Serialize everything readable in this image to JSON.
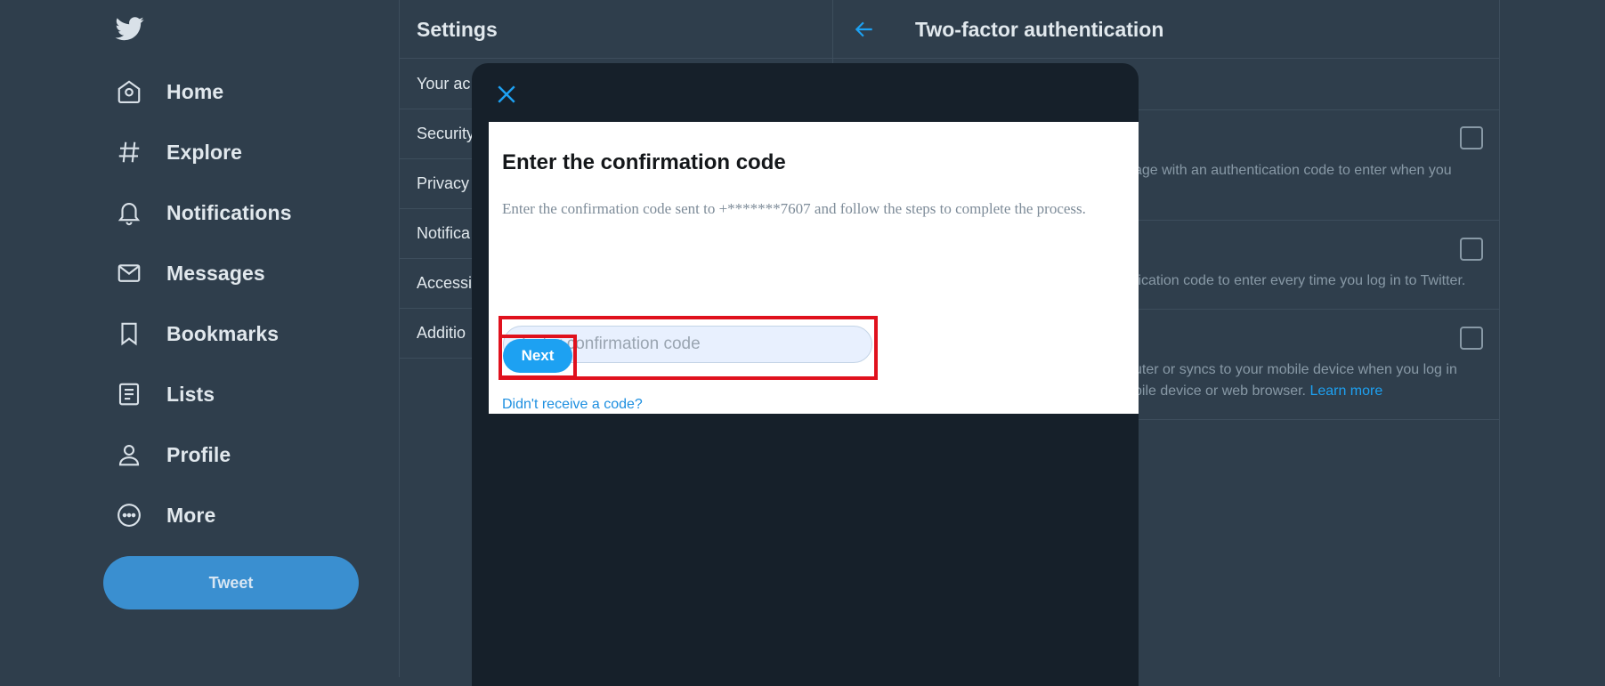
{
  "colors": {
    "accent": "#1da1f2",
    "background": "#2f3e4c",
    "modal": "#16202a",
    "highlight": "#e0111d"
  },
  "nav": {
    "logo_icon": "twitter-bird-icon",
    "items": [
      {
        "label": "Home",
        "icon": "home-icon"
      },
      {
        "label": "Explore",
        "icon": "hashtag-icon"
      },
      {
        "label": "Notifications",
        "icon": "bell-icon"
      },
      {
        "label": "Messages",
        "icon": "envelope-icon"
      },
      {
        "label": "Bookmarks",
        "icon": "bookmark-icon"
      },
      {
        "label": "Lists",
        "icon": "list-icon"
      },
      {
        "label": "Profile",
        "icon": "person-icon"
      },
      {
        "label": "More",
        "icon": "more-icon"
      }
    ],
    "tweet_label": "Tweet"
  },
  "settings": {
    "title": "Settings",
    "items": [
      {
        "label": "Your ac"
      },
      {
        "label": "Security"
      },
      {
        "label": "Privacy"
      },
      {
        "label": "Notifica"
      },
      {
        "label": "Accessil"
      },
      {
        "label": "Additio"
      }
    ]
  },
  "tfa": {
    "title": "Two-factor authentication",
    "sections": [
      {
        "line1": "age with an authentication code to enter when you",
        "line2": ""
      },
      {
        "line1": "fication code to enter every time you log in to Twitter.",
        "line2": ""
      },
      {
        "line1": "uter or syncs to your mobile device when you log in",
        "line2": "bile device or web browser.",
        "link": "Learn more"
      }
    ]
  },
  "modal": {
    "title": "Enter the confirmation code",
    "description": "Enter the confirmation code sent to +*******7607 and follow the steps to complete the process.",
    "input_placeholder": "Enter confirmation code",
    "input_value": "",
    "next_label": "Next",
    "resend_label": "Didn't receive a code?"
  }
}
